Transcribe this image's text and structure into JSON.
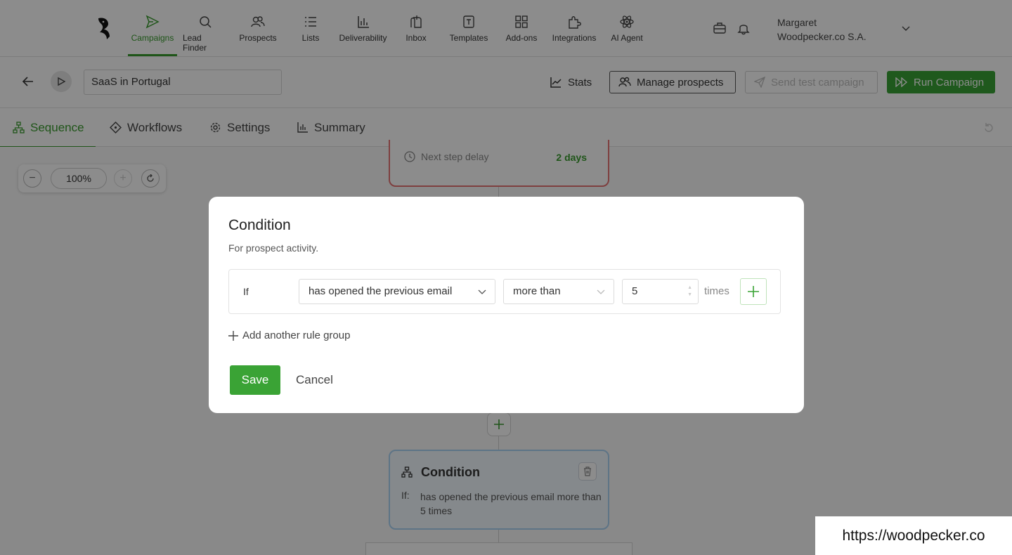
{
  "nav": {
    "items": [
      {
        "label": "Campaigns",
        "icon": "send-icon",
        "active": true
      },
      {
        "label": "Lead Finder",
        "icon": "search-icon"
      },
      {
        "label": "Prospects",
        "icon": "users-icon"
      },
      {
        "label": "Lists",
        "icon": "list-icon"
      },
      {
        "label": "Deliverability",
        "icon": "bar-chart-icon"
      },
      {
        "label": "Inbox",
        "icon": "mailbox-icon"
      },
      {
        "label": "Templates",
        "icon": "template-icon"
      },
      {
        "label": "Add-ons",
        "icon": "grid-icon"
      },
      {
        "label": "Integrations",
        "icon": "puzzle-icon"
      },
      {
        "label": "AI Agent",
        "icon": "atom-icon"
      }
    ],
    "user_name": "Margaret",
    "user_company": "Woodpecker.co S.A."
  },
  "campaign": {
    "name": "SaaS in Portugal",
    "stats_label": "Stats",
    "manage_label": "Manage prospects",
    "test_label": "Send test campaign",
    "run_label": "Run Campaign"
  },
  "tabs": [
    {
      "label": "Sequence",
      "active": true
    },
    {
      "label": "Workflows"
    },
    {
      "label": "Settings"
    },
    {
      "label": "Summary"
    }
  ],
  "canvas": {
    "zoom": "100%",
    "delay_label": "Next step delay",
    "delay_value": "2 days",
    "condition_title": "Condition",
    "condition_if": "If:",
    "condition_text": "has opened the previous email more than 5 times"
  },
  "modal": {
    "title": "Condition",
    "subtitle": "For prospect activity.",
    "if_label": "If",
    "event": "has opened the previous email",
    "comparator": "more than",
    "count": "5",
    "unit": "times",
    "add_group_label": "Add another rule group",
    "save_label": "Save",
    "cancel_label": "Cancel"
  },
  "watermark": "https://woodpecker.co",
  "colors": {
    "accent": "#3aa335",
    "delay_border": "#e57373",
    "condition_border": "#aad3f5"
  }
}
